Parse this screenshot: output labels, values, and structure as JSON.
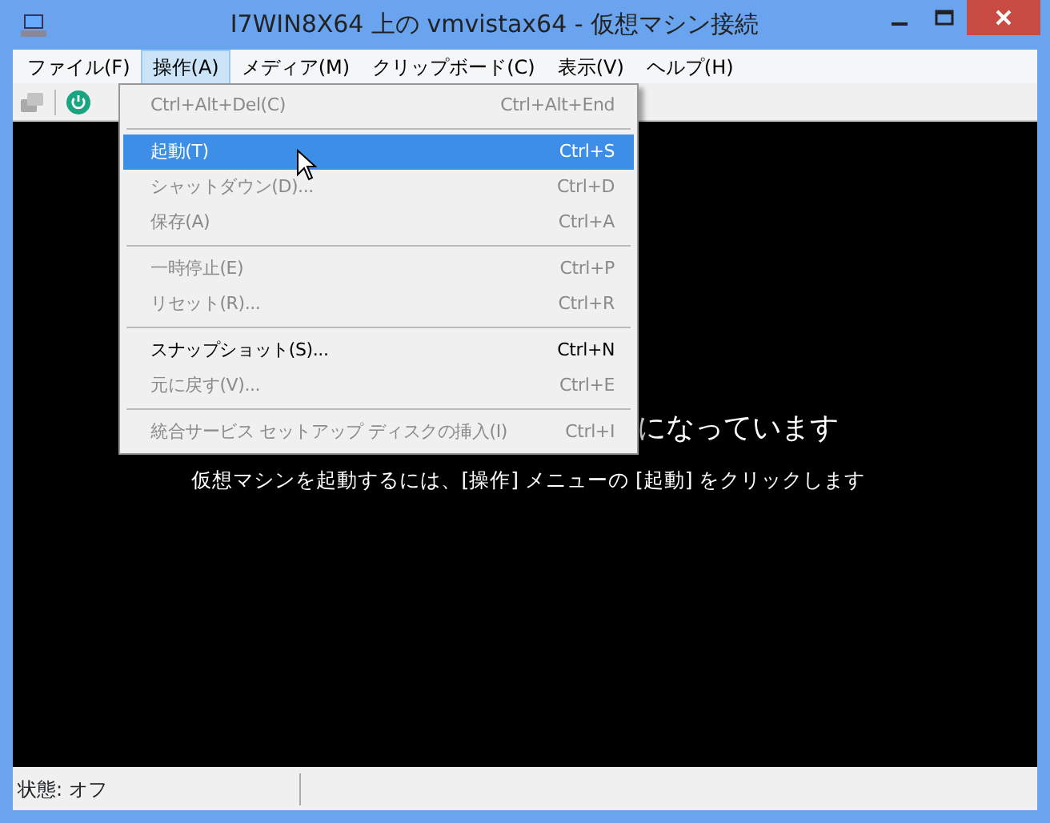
{
  "window": {
    "title": "I7WIN8X64 上の vmvistax64  - 仮想マシン接続"
  },
  "menu_bar": [
    {
      "label": "ファイル(F)",
      "selected": false
    },
    {
      "label": "操作(A)",
      "selected": true
    },
    {
      "label": "メディア(M)",
      "selected": false
    },
    {
      "label": "クリップボード(C)",
      "selected": false
    },
    {
      "label": "表示(V)",
      "selected": false
    },
    {
      "label": "ヘルプ(H)",
      "selected": false
    }
  ],
  "dropdown": [
    {
      "kind": "item",
      "label": "Ctrl+Alt+Del(C)",
      "shortcut": "Ctrl+Alt+End",
      "disabled": true,
      "selected": false
    },
    {
      "kind": "separator"
    },
    {
      "kind": "item",
      "label": "起動(T)",
      "shortcut": "Ctrl+S",
      "disabled": false,
      "selected": true
    },
    {
      "kind": "item",
      "label": "シャットダウン(D)...",
      "shortcut": "Ctrl+D",
      "disabled": true,
      "selected": false
    },
    {
      "kind": "item",
      "label": "保存(A)",
      "shortcut": "Ctrl+A",
      "disabled": true,
      "selected": false
    },
    {
      "kind": "separator"
    },
    {
      "kind": "item",
      "label": "一時停止(E)",
      "shortcut": "Ctrl+P",
      "disabled": true,
      "selected": false
    },
    {
      "kind": "item",
      "label": "リセット(R)...",
      "shortcut": "Ctrl+R",
      "disabled": true,
      "selected": false
    },
    {
      "kind": "separator"
    },
    {
      "kind": "item",
      "label": "スナップショット(S)...",
      "shortcut": "Ctrl+N",
      "disabled": false,
      "selected": false
    },
    {
      "kind": "item",
      "label": "元に戻す(V)...",
      "shortcut": "Ctrl+E",
      "disabled": true,
      "selected": false
    },
    {
      "kind": "separator"
    },
    {
      "kind": "item",
      "label": "統合サービス セットアップ ディスクの挿入(I)",
      "shortcut": "Ctrl+I",
      "disabled": true,
      "selected": false
    }
  ],
  "screen": {
    "message": "になっています",
    "hint": "仮想マシンを起動するには、[操作] メニューの [起動] をクリックします"
  },
  "status_bar": {
    "status": "状態: オフ"
  }
}
